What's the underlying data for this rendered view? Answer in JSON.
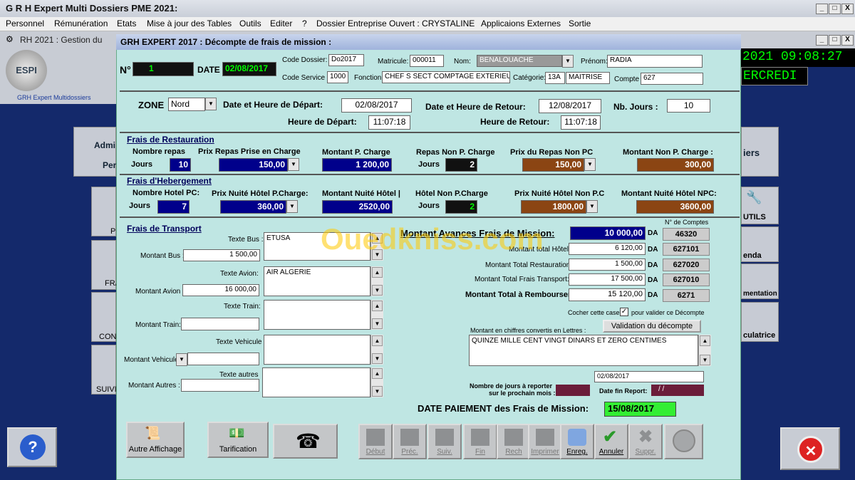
{
  "app": {
    "title": "G R H Expert Multi Dossiers PME 2021:",
    "sub_title": "RH 2021 : Gestion du"
  },
  "menu": [
    "Personnel",
    "Rémunération",
    "Etats",
    "Mise à jour des Tables",
    "Outils",
    "Editer",
    "?",
    "Dossier Entreprise Ouvert : CRYSTALINE",
    "Applicaions Externes",
    "Sortie"
  ],
  "window_btns": {
    "min": "_",
    "max": "□",
    "close": "X"
  },
  "bg": {
    "logo": "ESPI",
    "logo_sub": "GRH Expert Multidossiers",
    "clock": "2021 09:08:27",
    "day": "ERCREDI",
    "side_left": [
      "Admi",
      "Per",
      "P",
      "FRA",
      "CONC",
      "SUIVI"
    ],
    "side_right": [
      "iers",
      "UTILS",
      "enda",
      "mentation",
      "culatrice"
    ]
  },
  "dialog": {
    "title": "GRH EXPERT 2017 : Décompte de frais de mission  :",
    "no_label": "N°",
    "no": "1",
    "date_label": "DATE",
    "date": "02/08/2017",
    "code_dossier_label": "Code Dossier:",
    "code_dossier": "Do2017",
    "matricule_label": "Matricule:",
    "matricule": "000011",
    "nom_label": "Nom:",
    "nom": "BENALOUACHE",
    "prenom_label": "Prénom:",
    "prenom": "RADIA",
    "code_service_label": "Code Service",
    "code_service": "1000",
    "fonction_label": "Fonction",
    "fonction": "CHEF S SECT COMPTAGE EXTERIEUR",
    "categorie_label": "Catégorie:",
    "categorie_code": "13A",
    "categorie": "MAITRISE",
    "compte_label": "Compte",
    "compte": "627",
    "zone_label": "ZONE",
    "zone": "Nord",
    "depart_label": "Date et Heure de Départ:",
    "depart_date": "02/08/2017",
    "retour_label": "Date et Heure de Retour:",
    "retour_date": "12/08/2017",
    "nbjours_label": "Nb. Jours :",
    "nbjours": "10",
    "hdepart_label": "Heure de Départ:",
    "hdepart": "11:07:18",
    "hretour_label": "Heure de Retour:",
    "hretour": "11:07:18"
  },
  "restauration": {
    "title": "Frais de Restauration",
    "nb_repas_label": "Nombre repas",
    "jours_label": "Jours",
    "nb_repas": "10",
    "prix_pc_label": "Prix Repas Prise en Charge",
    "prix_pc": "150,00",
    "montant_pc_label": "Montant P. Charge",
    "montant_pc": "1 200,00",
    "repas_npc_label": "Repas Non P. Charge",
    "jours2_label": "Jours",
    "repas_npc": "2",
    "prix_npc_label": "Prix du Repas Non PC",
    "prix_npc": "150,00",
    "montant_npc_label": "Montant Non P. Charge :",
    "montant_npc": "300,00"
  },
  "hebergement": {
    "title": "Frais d'Hebergement",
    "nb_label": "Nombre Hotel PC:",
    "jours_label": "Jours",
    "nb": "7",
    "prix_pc_label": "Prix Nuité Hôtel P.Charge:",
    "prix_pc": "360,00",
    "montant_label": "Montant Nuité Hôtel  |",
    "montant": "2520,00",
    "npc_label": "Hôtel Non P.Charge",
    "jours2_label": "Jours",
    "npc": "2",
    "prix_npc_label": "Prix Nuité Hôtel Non P.C",
    "prix_npc": "1800,00",
    "montant_npc_label": "Montant Nuité Hôtel  NPC:",
    "montant_npc": "3600,00"
  },
  "transport": {
    "title": "Frais de Transport",
    "texte_bus_label": "Texte Bus :",
    "texte_bus": "ETUSA",
    "montant_bus_label": "Montant Bus :",
    "montant_bus": "1 500,00",
    "texte_avion_label": "Texte Avion:",
    "texte_avion": "AIR ALGERIE",
    "montant_avion_label": "Montant Avion",
    "montant_avion": "16 000,00",
    "texte_train_label": "Texte Train:",
    "montant_train_label": "Montant Train:",
    "texte_vehicule_label": "Texte Vehicule :",
    "montant_vehicule_label": "Montant Vehicule",
    "texte_autres_label": "Texte autres",
    "montant_autres_label": "Montant  Autres :"
  },
  "totals": {
    "avances_label": "Montant Avances Frais de Mission:",
    "avances": "10 000,00",
    "hotel_label": "Montant total Hôtel :",
    "hotel": "6 120,00",
    "restauration_label": "Montant Total Restauration :",
    "restauration": "1 500,00",
    "transport_label": "Montant Total  Frais Transport:",
    "transport": "17 500,00",
    "rembourser_label": "Montant Total à Rembourser:",
    "rembourser": "15 120,00",
    "da": "DA",
    "comptes_label": "N° de Comptes",
    "comptes": [
      "46320",
      "627101",
      "627020",
      "627010",
      "6271"
    ],
    "cocher_label": "Cocher cette case",
    "valider_label": "pour valider ce Décompte",
    "lettres_label": "Montant en chiffres convertis en Lettres :",
    "validation_btn": "Validation du décompte",
    "lettres": "QUINZE MILLE  CENT VINGT DINARS ET ZERO CENTIMES",
    "date_fin": "02/08/2017",
    "report_label_1": "Nombre de jours à reporter",
    "report_label_2": "sur le prochain mois :",
    "date_fin_label": "Date fin Report:",
    "date_fin_report": "/ /",
    "paiement_label": "DATE PAIEMENT des Frais de Mission:",
    "paiement": "15/08/2017"
  },
  "toolbar": {
    "autre": "Autre Affichage",
    "tarification": "Tarification",
    "nav": [
      "Début",
      "Préc.",
      "Suiv.",
      "Fin",
      "Rech",
      "Imprimer",
      "Enreg.",
      "Annuler",
      "Suppr."
    ]
  },
  "watermark": "Ouedkniss.com",
  "colors": {
    "panel": "#bfe6e3",
    "navy": "#00008b",
    "brown": "#8b4513",
    "green": "#33ee33"
  }
}
